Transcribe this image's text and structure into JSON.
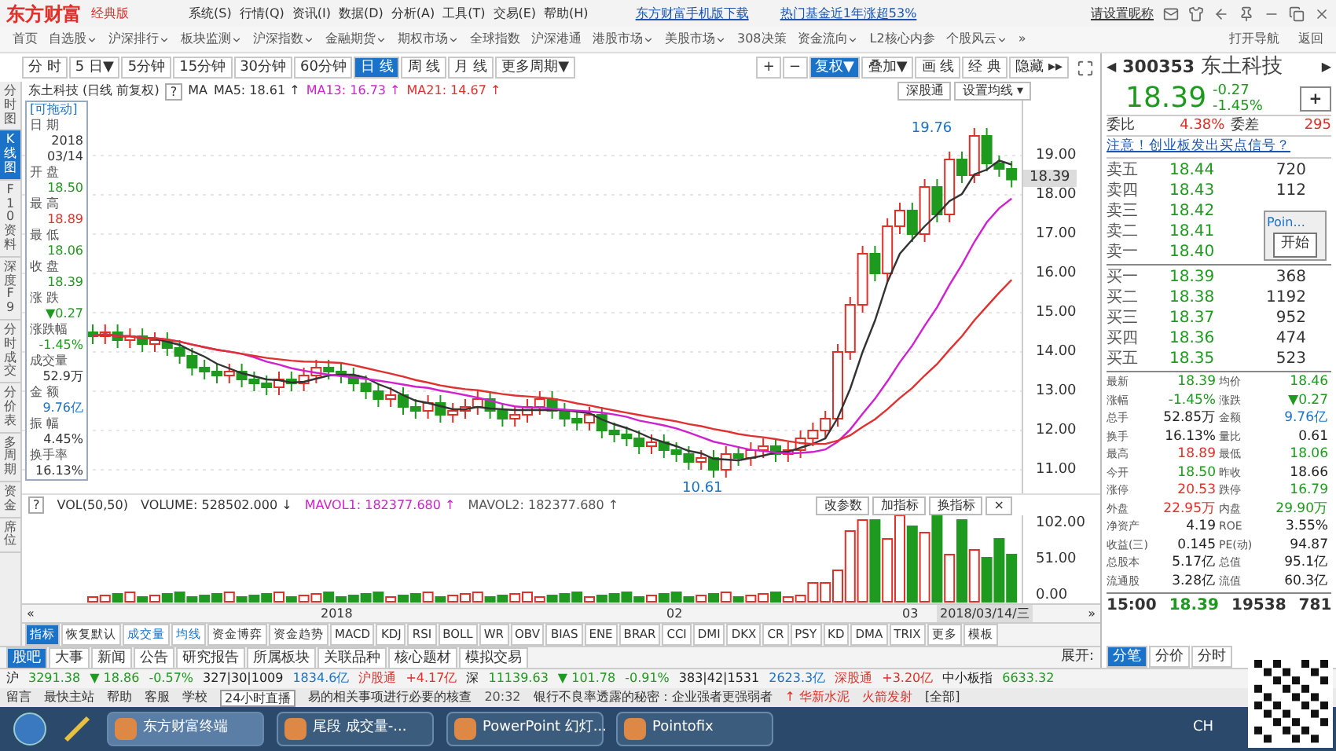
{
  "title_bar": {
    "logo": "东方财富",
    "edition": "经典版",
    "menus": [
      "系统(S)",
      "行情(Q)",
      "资讯(I)",
      "数据(D)",
      "分析(A)",
      "工具(T)",
      "交易(E)",
      "帮助(H)"
    ],
    "links": [
      "东方财富手机版下载",
      "热门基金近1年涨超53%"
    ],
    "nickname": "请设置昵称"
  },
  "nav": {
    "items": [
      {
        "label": "首页",
        "dropdown": false
      },
      {
        "label": "自选股",
        "dropdown": true
      },
      {
        "label": "沪深排行",
        "dropdown": true
      },
      {
        "label": "板块监测",
        "dropdown": true
      },
      {
        "label": "沪深指数",
        "dropdown": true
      },
      {
        "label": "金融期货",
        "dropdown": true
      },
      {
        "label": "期权市场",
        "dropdown": true
      },
      {
        "label": "全球指数",
        "dropdown": false
      },
      {
        "label": "沪深港通",
        "dropdown": false
      },
      {
        "label": "港股市场",
        "dropdown": true
      },
      {
        "label": "美股市场",
        "dropdown": true
      },
      {
        "label": "308决策",
        "dropdown": false
      },
      {
        "label": "资金流向",
        "dropdown": true
      },
      {
        "label": "L2核心内参",
        "dropdown": false
      },
      {
        "label": "个股风云",
        "dropdown": true
      }
    ],
    "more": "»",
    "right": [
      "打开导航",
      "返回"
    ]
  },
  "periods": [
    {
      "label": "分 时",
      "selected": false
    },
    {
      "label": "5 日▼",
      "selected": false
    },
    {
      "label": "5分钟",
      "selected": false
    },
    {
      "label": "15分钟",
      "selected": false
    },
    {
      "label": "30分钟",
      "selected": false
    },
    {
      "label": "60分钟",
      "selected": false
    },
    {
      "label": "日 线",
      "selected": true
    },
    {
      "label": "周 线",
      "selected": false
    },
    {
      "label": "月 线",
      "selected": false
    },
    {
      "label": "更多周期▼",
      "selected": false
    }
  ],
  "chart_tools": [
    {
      "label": "+",
      "selected": false
    },
    {
      "label": "−",
      "selected": false
    },
    {
      "label": "复权▼",
      "selected": true
    },
    {
      "label": "叠加▼",
      "selected": false
    },
    {
      "label": "画 线",
      "selected": false
    },
    {
      "label": "经 典",
      "selected": false
    },
    {
      "label": "隐藏 ▸▸",
      "selected": false
    }
  ],
  "side_tabs": [
    {
      "label": "分时图",
      "selected": false
    },
    {
      "label": "K线图",
      "selected": true
    },
    {
      "label": "F10资料",
      "selected": false
    },
    {
      "label": "深度F9",
      "selected": false
    },
    {
      "label": "分时成交",
      "selected": false
    },
    {
      "label": "分价表",
      "selected": false
    },
    {
      "label": "多周期",
      "selected": false
    },
    {
      "label": "资金",
      "selected": false
    },
    {
      "label": "席位",
      "selected": false
    }
  ],
  "chart": {
    "title": "东土科技 (日线 前复权)",
    "help": "?",
    "ma_label": "MA",
    "ma": [
      {
        "label": "MA5: 18.61 ↑",
        "color": "#333333"
      },
      {
        "label": "MA13: 16.73 ↑",
        "color": "#d020d0"
      },
      {
        "label": "MA21: 14.67 ↑",
        "color": "#e03030"
      }
    ],
    "buttons": [
      "深股通",
      "设置均线 ▾"
    ],
    "price_axis": [
      "19.00",
      "18.00",
      "17.00",
      "16.00",
      "15.00",
      "14.00",
      "13.00",
      "12.00",
      "11.00"
    ],
    "current_price": "18.39",
    "high_note": "19.76",
    "low_note": "10.61"
  },
  "info_box": {
    "title": "[可拖动]",
    "items": [
      {
        "label": "日 期",
        "lines": [
          "2018",
          "03/14"
        ],
        "color": "#333333"
      },
      {
        "label": "开 盘",
        "lines": [
          "18.50"
        ],
        "color": "#1e9a1e"
      },
      {
        "label": "最 高",
        "lines": [
          "18.89"
        ],
        "color": "#e0302a"
      },
      {
        "label": "最 低",
        "lines": [
          "18.06"
        ],
        "color": "#1e9a1e"
      },
      {
        "label": "收 盘",
        "lines": [
          "18.39"
        ],
        "color": "#1e9a1e"
      },
      {
        "label": "涨 跌",
        "lines": [
          "▼0.27"
        ],
        "color": "#1e9a1e"
      },
      {
        "label": "涨跌幅",
        "lines": [
          "-1.45%"
        ],
        "color": "#1e9a1e"
      },
      {
        "label": "成交量",
        "lines": [
          "52.9万"
        ],
        "color": "#333333"
      },
      {
        "label": "金 额",
        "lines": [
          "9.76亿"
        ],
        "color": "#1a73c8"
      },
      {
        "label": "振 幅",
        "lines": [
          "4.45%"
        ],
        "color": "#333333"
      },
      {
        "label": "换手率",
        "lines": [
          "16.13%"
        ],
        "color": "#333333"
      }
    ]
  },
  "volume": {
    "help": "?",
    "items": [
      {
        "label": "VOL(50,50)",
        "color": "#333333"
      },
      {
        "label": "VOLUME: 528502.000 ↓",
        "color": "#333333"
      },
      {
        "label": "MAVOL1: 182377.680 ↑",
        "color": "#d020d0"
      },
      {
        "label": "MAVOL2: 182377.680 ↑",
        "color": "#555555"
      }
    ],
    "buttons": [
      "改参数",
      "加指标",
      "换指标"
    ],
    "close": "×",
    "axis": [
      "102.00",
      "51.00",
      "0.00"
    ]
  },
  "date_axis": {
    "labels": [
      "2018",
      "02",
      "03"
    ],
    "cursor_date": "2018/03/14/三",
    "left": "«",
    "right": "»"
  },
  "indicator_tabs": [
    {
      "label": "指标",
      "selected": true,
      "highlighted": false
    },
    {
      "label": "恢复默认",
      "selected": false,
      "highlighted": false
    },
    {
      "label": "成交量",
      "selected": false,
      "highlighted": true
    },
    {
      "label": "均线",
      "selected": false,
      "highlighted": true
    },
    {
      "label": "资金博弈",
      "selected": false,
      "highlighted": false
    },
    {
      "label": "资金趋势",
      "selected": false,
      "highlighted": false
    },
    {
      "label": "MACD",
      "selected": false,
      "highlighted": false
    },
    {
      "label": "KDJ",
      "selected": false,
      "highlighted": false
    },
    {
      "label": "RSI",
      "selected": false,
      "highlighted": false
    },
    {
      "label": "BOLL",
      "selected": false,
      "highlighted": false
    },
    {
      "label": "WR",
      "selected": false,
      "highlighted": false
    },
    {
      "label": "OBV",
      "selected": false,
      "highlighted": false
    },
    {
      "label": "BIAS",
      "selected": false,
      "highlighted": false
    },
    {
      "label": "ENE",
      "selected": false,
      "highlighted": false
    },
    {
      "label": "BRAR",
      "selected": false,
      "highlighted": false
    },
    {
      "label": "CCI",
      "selected": false,
      "highlighted": false
    },
    {
      "label": "DMI",
      "selected": false,
      "highlighted": false
    },
    {
      "label": "DKX",
      "selected": false,
      "highlighted": false
    },
    {
      "label": "CR",
      "selected": false,
      "highlighted": false
    },
    {
      "label": "PSY",
      "selected": false,
      "highlighted": false
    },
    {
      "label": "KD",
      "selected": false,
      "highlighted": false
    },
    {
      "label": "DMA",
      "selected": false,
      "highlighted": false
    },
    {
      "label": "TRIX",
      "selected": false,
      "highlighted": false
    },
    {
      "label": "更多",
      "selected": false,
      "highlighted": false
    },
    {
      "label": "模板",
      "selected": false,
      "highlighted": false
    }
  ],
  "news_tabs": [
    {
      "label": "股吧",
      "selected": true
    },
    {
      "label": "大事",
      "selected": false
    },
    {
      "label": "新闻",
      "selected": false
    },
    {
      "label": "公告",
      "selected": false
    },
    {
      "label": "研究报告",
      "selected": false
    },
    {
      "label": "所属板块",
      "selected": false
    },
    {
      "label": "关联品种",
      "selected": false
    },
    {
      "label": "核心题材",
      "selected": false
    },
    {
      "label": "模拟交易",
      "selected": false
    }
  ],
  "expand": "展开:",
  "quote": {
    "prev": "◀",
    "code": "300353",
    "name": "东土科技",
    "next": "▶",
    "price": "18.39",
    "change": "-0.27",
    "change_pct": "-1.45%",
    "add": "+",
    "ratio_label": "委比",
    "ratio": "4.38%",
    "diff_label": "委差",
    "diff": "295",
    "notice": "注意！创业板发出买点信号？",
    "asks": [
      {
        "label": "卖五",
        "price": "18.44",
        "volume": "720"
      },
      {
        "label": "卖四",
        "price": "18.43",
        "volume": "112"
      },
      {
        "label": "卖三",
        "price": "18.42"
      },
      {
        "label": "卖二",
        "price": "18.41"
      },
      {
        "label": "卖一",
        "price": "18.40"
      }
    ],
    "bids": [
      {
        "label": "买一",
        "price": "18.39",
        "volume": "368"
      },
      {
        "label": "买二",
        "price": "18.38",
        "volume": "1192"
      },
      {
        "label": "买三",
        "price": "18.37",
        "volume": "952"
      },
      {
        "label": "买四",
        "price": "18.36",
        "volume": "474"
      },
      {
        "label": "买五",
        "price": "18.35",
        "volume": "523"
      }
    ],
    "stats": [
      {
        "label": "最新",
        "value": "18.39",
        "color": "#1e9a1e"
      },
      {
        "label": "均价",
        "value": "18.46",
        "color": "#1e9a1e"
      },
      {
        "label": "涨幅",
        "value": "-1.45%",
        "color": "#1e9a1e"
      },
      {
        "label": "涨跌",
        "value": "▼0.27",
        "color": "#1e9a1e"
      },
      {
        "label": "总手",
        "value": "52.85万",
        "color": "#222222"
      },
      {
        "label": "金额",
        "value": "9.76亿",
        "color": "#1a73c8"
      },
      {
        "label": "换手",
        "value": "16.13%",
        "color": "#222222"
      },
      {
        "label": "量比",
        "value": "0.61",
        "color": "#222222"
      },
      {
        "label": "最高",
        "value": "18.89",
        "color": "#e0302a"
      },
      {
        "label": "最低",
        "value": "18.06",
        "color": "#1e9a1e"
      },
      {
        "label": "今开",
        "value": "18.50",
        "color": "#1e9a1e"
      },
      {
        "label": "昨收",
        "value": "18.66",
        "color": "#222222"
      },
      {
        "label": "涨停",
        "value": "20.53",
        "color": "#e0302a"
      },
      {
        "label": "跌停",
        "value": "16.79",
        "color": "#1e9a1e"
      },
      {
        "label": "外盘",
        "value": "22.95万",
        "color": "#e0302a"
      },
      {
        "label": "内盘",
        "value": "29.90万",
        "color": "#1e9a1e"
      },
      {
        "label": "净资产",
        "value": "4.19",
        "color": "#222222"
      },
      {
        "label": "ROE",
        "value": "3.55%",
        "color": "#222222"
      },
      {
        "label": "收益(三)",
        "value": "0.145",
        "color": "#222222"
      },
      {
        "label": "PE(动)",
        "value": "94.87",
        "color": "#222222"
      },
      {
        "label": "总股本",
        "value": "5.17亿",
        "color": "#222222"
      },
      {
        "label": "总值",
        "value": "95.1亿",
        "color": "#222222"
      },
      {
        "label": "流通股",
        "value": "3.28亿",
        "color": "#222222"
      },
      {
        "label": "流值",
        "value": "60.3亿",
        "color": "#222222"
      }
    ],
    "tick": {
      "time": "15:00",
      "price": "18.39",
      "volume": "19538",
      "count": "781"
    },
    "tabs": [
      {
        "label": "分笔",
        "selected": true
      },
      {
        "label": "分价",
        "selected": false
      },
      {
        "label": "分时",
        "selected": false
      }
    ]
  },
  "popup": {
    "title": "Poin...",
    "button": "开始"
  },
  "ticker": [
    {
      "text": "沪",
      "color": "#222222"
    },
    {
      "text": "3291.38",
      "color": "#1e9a1e"
    },
    {
      "text": "▼ 18.86",
      "color": "#1e9a1e"
    },
    {
      "text": "-0.57%",
      "color": "#1e9a1e"
    },
    {
      "text": "327|30|1009",
      "color": "#222222"
    },
    {
      "text": "1834.6亿",
      "color": "#1a73c8"
    },
    {
      "text": "沪股通",
      "color": "#e0302a"
    },
    {
      "text": "+4.17亿",
      "color": "#e0302a"
    },
    {
      "text": "深",
      "color": "#222222"
    },
    {
      "text": "11139.63",
      "color": "#1e9a1e"
    },
    {
      "text": "▼ 101.78",
      "color": "#1e9a1e"
    },
    {
      "text": "-0.91%",
      "color": "#1e9a1e"
    },
    {
      "text": "383|42|1531",
      "color": "#222222"
    },
    {
      "text": "2623.3亿",
      "color": "#1a73c8"
    },
    {
      "text": "深股通",
      "color": "#e0302a"
    },
    {
      "text": "+3.20亿",
      "color": "#e0302a"
    },
    {
      "text": "中小板指",
      "color": "#222222"
    },
    {
      "text": "6633.32",
      "color": "#1e9a1e"
    }
  ],
  "status": {
    "links": [
      "留言",
      "最快主站",
      "帮助",
      "客服",
      "学校"
    ],
    "live": "24小时直播",
    "headline": "易的相关事项进行必要的核查",
    "time": "20:32",
    "news": "银行不良率透露的秘密：企业强者更强弱者",
    "stock": "↑ 华新水泥",
    "signal": "火箭发射",
    "all": "[全部]"
  },
  "taskbar": {
    "items": [
      {
        "label": "东方财富终端",
        "active": true
      },
      {
        "label": "尾段 成交量-...",
        "active": false
      },
      {
        "label": "PowerPoint 幻灯...",
        "active": false
      },
      {
        "label": "Pointofix",
        "active": false
      }
    ],
    "lang": "CH"
  }
}
